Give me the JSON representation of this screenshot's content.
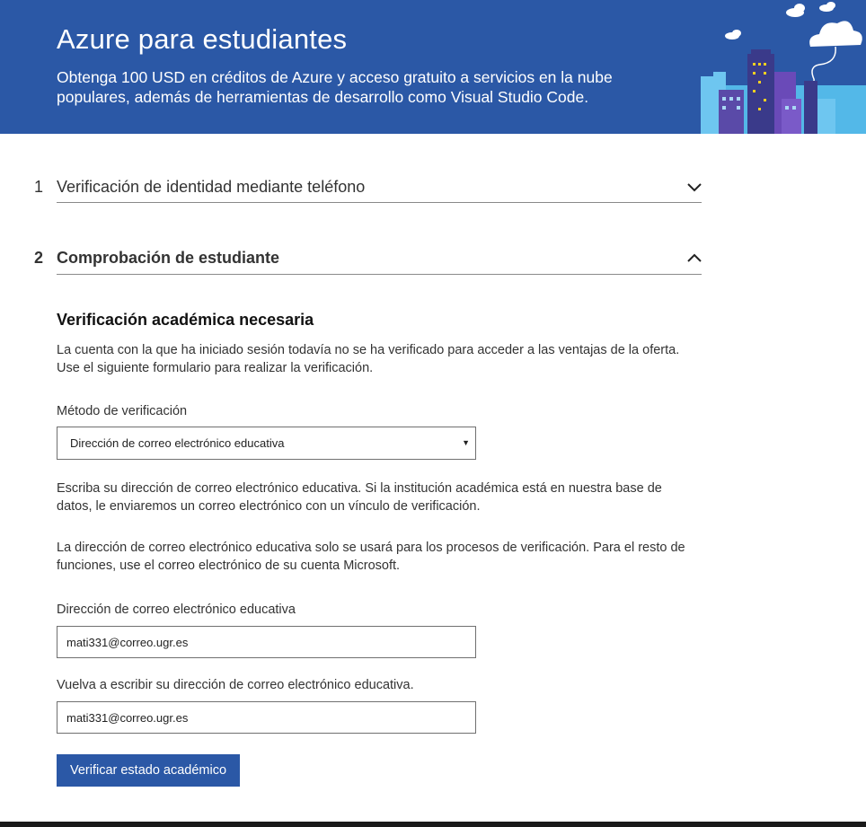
{
  "banner": {
    "title": "Azure para estudiantes",
    "subtitle": "Obtenga 100 USD en créditos de Azure y acceso gratuito a servicios en la nube populares, además de herramientas de desarrollo como Visual Studio Code."
  },
  "steps": [
    {
      "number": "1",
      "title": "Verificación de identidad mediante teléfono",
      "expanded": false,
      "icon": "chevron-down-icon"
    },
    {
      "number": "2",
      "title": "Comprobación de estudiante",
      "expanded": true,
      "icon": "chevron-up-icon"
    }
  ],
  "verification": {
    "heading": "Verificación académica necesaria",
    "intro": "La cuenta con la que ha iniciado sesión todavía no se ha verificado para acceder a las ventajas de la oferta. Use el siguiente formulario para realizar la verificación.",
    "method_label": "Método de verificación",
    "method_value": "Dirección de correo electrónico educativa",
    "instructions": "Escriba su dirección de correo electrónico educativa. Si la institución académica está en nuestra base de datos, le enviaremos un correo electrónico con un vínculo de verificación.",
    "usage_note": "La dirección de correo electrónico educativa solo se usará para los procesos de verificación. Para el resto de funciones, use el correo electrónico de su cuenta Microsoft.",
    "email_label": "Dirección de correo electrónico educativa",
    "email_value": "mati331@correo.ugr.es",
    "confirm_label": "Vuelva a escribir su dirección de correo electrónico educativa.",
    "confirm_value": "mati331@correo.ugr.es",
    "submit_label": "Verificar estado académico"
  },
  "colors": {
    "brand_blue": "#2b58a6",
    "divider": "#8a8a8a"
  }
}
